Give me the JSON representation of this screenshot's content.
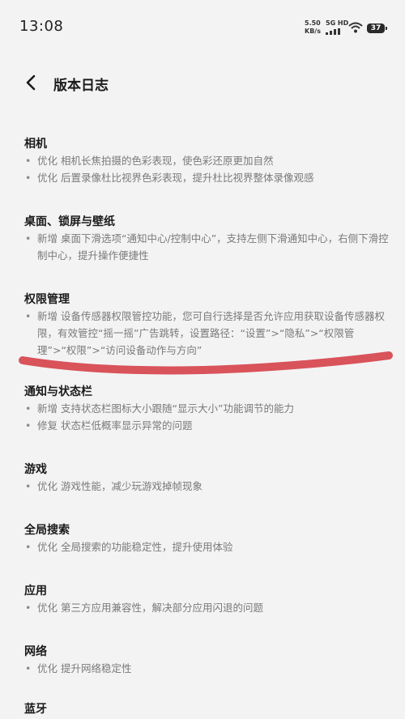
{
  "status": {
    "time": "13:08",
    "speed_value": "5.50",
    "speed_unit": "KB/s",
    "net_type": "5G HD",
    "battery": "37"
  },
  "header": {
    "title": "版本日志"
  },
  "sections": [
    {
      "title": "相机",
      "items": [
        {
          "tag": "优化",
          "text": "相机长焦拍摄的色彩表现，使色彩还原更加自然"
        },
        {
          "tag": "优化",
          "text": "后置录像杜比视界色彩表现，提升杜比视界整体录像观感"
        }
      ]
    },
    {
      "title": "桌面、锁屏与壁纸",
      "items": [
        {
          "tag": "新增",
          "text": "桌面下滑选项“通知中心/控制中心”，支持左侧下滑通知中心，右侧下滑控制中心，提升操作便捷性"
        }
      ]
    },
    {
      "title": "权限管理",
      "items": [
        {
          "tag": "新增",
          "text": "设备传感器权限管控功能，您可自行选择是否允许应用获取设备传感器权限，有效管控“摇一摇”广告跳转，设置路径：“设置”>“隐私”>“权限管理”>“权限”>“访问设备动作与方向”"
        }
      ]
    },
    {
      "title": "通知与状态栏",
      "items": [
        {
          "tag": "新增",
          "text": "支持状态栏图标大小跟随“显示大小”功能调节的能力"
        },
        {
          "tag": "修复",
          "text": "状态栏低概率显示异常的问题"
        }
      ]
    },
    {
      "title": "游戏",
      "items": [
        {
          "tag": "优化",
          "text": "游戏性能，减少玩游戏掉帧现象"
        }
      ]
    },
    {
      "title": "全局搜索",
      "items": [
        {
          "tag": "优化",
          "text": "全局搜索的功能稳定性，提升使用体验"
        }
      ]
    },
    {
      "title": "应用",
      "items": [
        {
          "tag": "优化",
          "text": "第三方应用兼容性，解决部分应用闪退的问题"
        }
      ]
    },
    {
      "title": "网络",
      "items": [
        {
          "tag": "优化",
          "text": "提升网络稳定性"
        }
      ]
    },
    {
      "title": "蓝牙",
      "items": []
    }
  ],
  "annotation_color": "#d9535a"
}
